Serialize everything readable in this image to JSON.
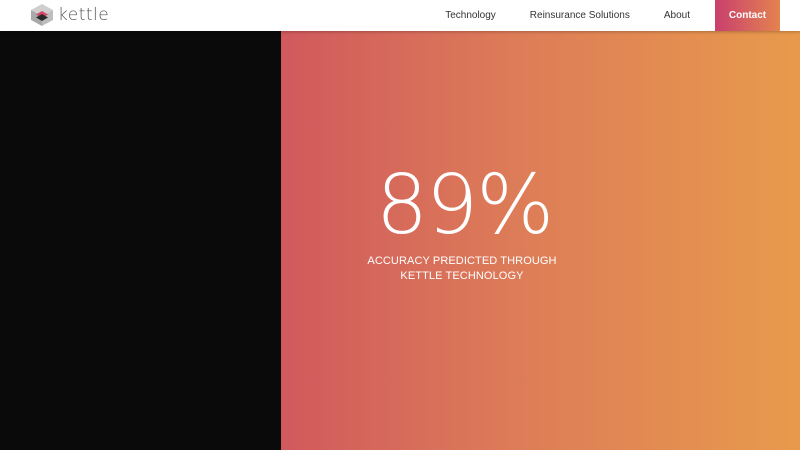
{
  "header": {
    "logo": {
      "text": "kettle",
      "icon": "kettle-cube-logo-icon"
    },
    "nav": {
      "technology": "Technology",
      "reinsurance": "Reinsurance Solutions",
      "about": "About",
      "contact": "Contact"
    }
  },
  "hero": {
    "stat_value": "89%",
    "stat_caption_line1": "ACCURACY PREDICTED THROUGH",
    "stat_caption_line2": "KETTLE TECHNOLOGY"
  },
  "colors": {
    "left_panel": "#0a0a0a",
    "gradient_start": "#d0595d",
    "gradient_end": "#e89a4c",
    "contact_start": "#c93f6e",
    "contact_end": "#e4834f"
  }
}
